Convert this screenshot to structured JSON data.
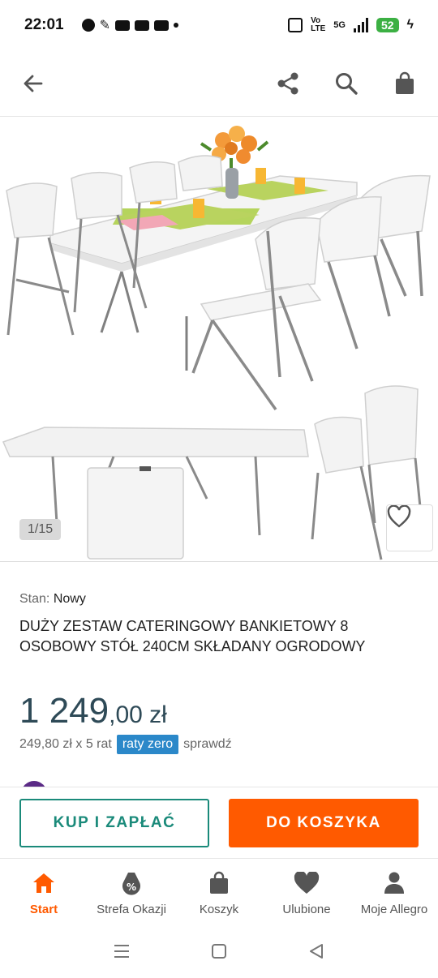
{
  "status_bar": {
    "time": "22:01",
    "volte_line1": "Vo",
    "volte_line2": "LTE",
    "network": "5G",
    "battery": "52"
  },
  "header": {
    "back_icon": "arrow-left-icon",
    "share_icon": "share-icon",
    "search_icon": "search-icon",
    "bag_icon": "shopping-bag-icon"
  },
  "gallery": {
    "counter": "1/15",
    "favorite_icon": "heart-icon"
  },
  "product": {
    "condition_label": "Stan:",
    "condition_value": "Nowy",
    "title": "DUŻY ZESTAW CATERINGOWY BANKIETOWY 8 OSOBOWY STÓŁ 240CM SKŁADANY OGRODOWY",
    "price_main": "1 249",
    "price_fraction": ",00 zł",
    "installment_text": "249,80 zł x 5 rat",
    "raty_badge": "raty zero",
    "check_text": "sprawdź"
  },
  "actions": {
    "buy_label": "KUP I ZAPŁAĆ",
    "cart_label": "DO KOSZYKA"
  },
  "bottom_nav": {
    "items": [
      {
        "label": "Start",
        "icon": "home-icon"
      },
      {
        "label": "Strefa Okazji",
        "icon": "deals-tag-icon"
      },
      {
        "label": "Koszyk",
        "icon": "cart-bag-icon"
      },
      {
        "label": "Ulubione",
        "icon": "heart-icon"
      },
      {
        "label": "Moje Allegro",
        "icon": "user-icon"
      }
    ]
  },
  "colors": {
    "accent": "#ff5a00",
    "teal": "#1a8a7a",
    "price": "#2e4a57",
    "raty": "#2b88c9"
  }
}
